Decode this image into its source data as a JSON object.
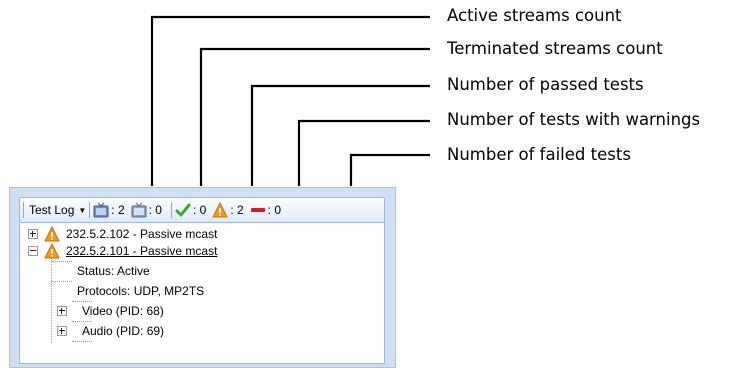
{
  "callouts": [
    {
      "label": "Active streams count"
    },
    {
      "label": "Terminated streams count"
    },
    {
      "label": "Number of passed tests"
    },
    {
      "label": "Number of tests with warnings"
    },
    {
      "label": "Number of failed tests"
    }
  ],
  "toolbar": {
    "dropdown_label": "Test Log",
    "active_streams": ": 2",
    "terminated_streams": ": 0",
    "passed": ": 0",
    "warnings": ": 2",
    "failed": ": 0"
  },
  "tree": {
    "nodes": [
      {
        "label": "232.5.2.102 - Passive mcast"
      },
      {
        "label": "232.5.2.101 - Passive mcast"
      },
      {
        "label": "Status: Active"
      },
      {
        "label": "Protocols: UDP, MP2TS"
      },
      {
        "label": "Video (PID: 68)"
      },
      {
        "label": "Audio (PID: 69)"
      }
    ]
  },
  "colors": {
    "panel_bg": "#cfe0f5",
    "warning": "#f39a1e",
    "passed": "#3aa82c",
    "failed": "#d01c2c",
    "stream_icon": "#5a7fb8"
  }
}
